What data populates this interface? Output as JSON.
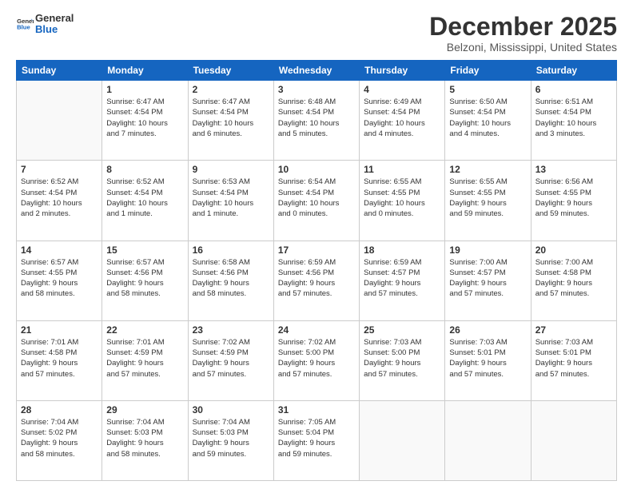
{
  "logo": {
    "line1": "General",
    "line2": "Blue"
  },
  "header": {
    "month": "December 2025",
    "location": "Belzoni, Mississippi, United States"
  },
  "weekdays": [
    "Sunday",
    "Monday",
    "Tuesday",
    "Wednesday",
    "Thursday",
    "Friday",
    "Saturday"
  ],
  "weeks": [
    [
      {
        "day": "",
        "info": ""
      },
      {
        "day": "1",
        "info": "Sunrise: 6:47 AM\nSunset: 4:54 PM\nDaylight: 10 hours\nand 7 minutes."
      },
      {
        "day": "2",
        "info": "Sunrise: 6:47 AM\nSunset: 4:54 PM\nDaylight: 10 hours\nand 6 minutes."
      },
      {
        "day": "3",
        "info": "Sunrise: 6:48 AM\nSunset: 4:54 PM\nDaylight: 10 hours\nand 5 minutes."
      },
      {
        "day": "4",
        "info": "Sunrise: 6:49 AM\nSunset: 4:54 PM\nDaylight: 10 hours\nand 4 minutes."
      },
      {
        "day": "5",
        "info": "Sunrise: 6:50 AM\nSunset: 4:54 PM\nDaylight: 10 hours\nand 4 minutes."
      },
      {
        "day": "6",
        "info": "Sunrise: 6:51 AM\nSunset: 4:54 PM\nDaylight: 10 hours\nand 3 minutes."
      }
    ],
    [
      {
        "day": "7",
        "info": "Sunrise: 6:52 AM\nSunset: 4:54 PM\nDaylight: 10 hours\nand 2 minutes."
      },
      {
        "day": "8",
        "info": "Sunrise: 6:52 AM\nSunset: 4:54 PM\nDaylight: 10 hours\nand 1 minute."
      },
      {
        "day": "9",
        "info": "Sunrise: 6:53 AM\nSunset: 4:54 PM\nDaylight: 10 hours\nand 1 minute."
      },
      {
        "day": "10",
        "info": "Sunrise: 6:54 AM\nSunset: 4:54 PM\nDaylight: 10 hours\nand 0 minutes."
      },
      {
        "day": "11",
        "info": "Sunrise: 6:55 AM\nSunset: 4:55 PM\nDaylight: 10 hours\nand 0 minutes."
      },
      {
        "day": "12",
        "info": "Sunrise: 6:55 AM\nSunset: 4:55 PM\nDaylight: 9 hours\nand 59 minutes."
      },
      {
        "day": "13",
        "info": "Sunrise: 6:56 AM\nSunset: 4:55 PM\nDaylight: 9 hours\nand 59 minutes."
      }
    ],
    [
      {
        "day": "14",
        "info": "Sunrise: 6:57 AM\nSunset: 4:55 PM\nDaylight: 9 hours\nand 58 minutes."
      },
      {
        "day": "15",
        "info": "Sunrise: 6:57 AM\nSunset: 4:56 PM\nDaylight: 9 hours\nand 58 minutes."
      },
      {
        "day": "16",
        "info": "Sunrise: 6:58 AM\nSunset: 4:56 PM\nDaylight: 9 hours\nand 58 minutes."
      },
      {
        "day": "17",
        "info": "Sunrise: 6:59 AM\nSunset: 4:56 PM\nDaylight: 9 hours\nand 57 minutes."
      },
      {
        "day": "18",
        "info": "Sunrise: 6:59 AM\nSunset: 4:57 PM\nDaylight: 9 hours\nand 57 minutes."
      },
      {
        "day": "19",
        "info": "Sunrise: 7:00 AM\nSunset: 4:57 PM\nDaylight: 9 hours\nand 57 minutes."
      },
      {
        "day": "20",
        "info": "Sunrise: 7:00 AM\nSunset: 4:58 PM\nDaylight: 9 hours\nand 57 minutes."
      }
    ],
    [
      {
        "day": "21",
        "info": "Sunrise: 7:01 AM\nSunset: 4:58 PM\nDaylight: 9 hours\nand 57 minutes."
      },
      {
        "day": "22",
        "info": "Sunrise: 7:01 AM\nSunset: 4:59 PM\nDaylight: 9 hours\nand 57 minutes."
      },
      {
        "day": "23",
        "info": "Sunrise: 7:02 AM\nSunset: 4:59 PM\nDaylight: 9 hours\nand 57 minutes."
      },
      {
        "day": "24",
        "info": "Sunrise: 7:02 AM\nSunset: 5:00 PM\nDaylight: 9 hours\nand 57 minutes."
      },
      {
        "day": "25",
        "info": "Sunrise: 7:03 AM\nSunset: 5:00 PM\nDaylight: 9 hours\nand 57 minutes."
      },
      {
        "day": "26",
        "info": "Sunrise: 7:03 AM\nSunset: 5:01 PM\nDaylight: 9 hours\nand 57 minutes."
      },
      {
        "day": "27",
        "info": "Sunrise: 7:03 AM\nSunset: 5:01 PM\nDaylight: 9 hours\nand 57 minutes."
      }
    ],
    [
      {
        "day": "28",
        "info": "Sunrise: 7:04 AM\nSunset: 5:02 PM\nDaylight: 9 hours\nand 58 minutes."
      },
      {
        "day": "29",
        "info": "Sunrise: 7:04 AM\nSunset: 5:03 PM\nDaylight: 9 hours\nand 58 minutes."
      },
      {
        "day": "30",
        "info": "Sunrise: 7:04 AM\nSunset: 5:03 PM\nDaylight: 9 hours\nand 59 minutes."
      },
      {
        "day": "31",
        "info": "Sunrise: 7:05 AM\nSunset: 5:04 PM\nDaylight: 9 hours\nand 59 minutes."
      },
      {
        "day": "",
        "info": ""
      },
      {
        "day": "",
        "info": ""
      },
      {
        "day": "",
        "info": ""
      }
    ]
  ]
}
